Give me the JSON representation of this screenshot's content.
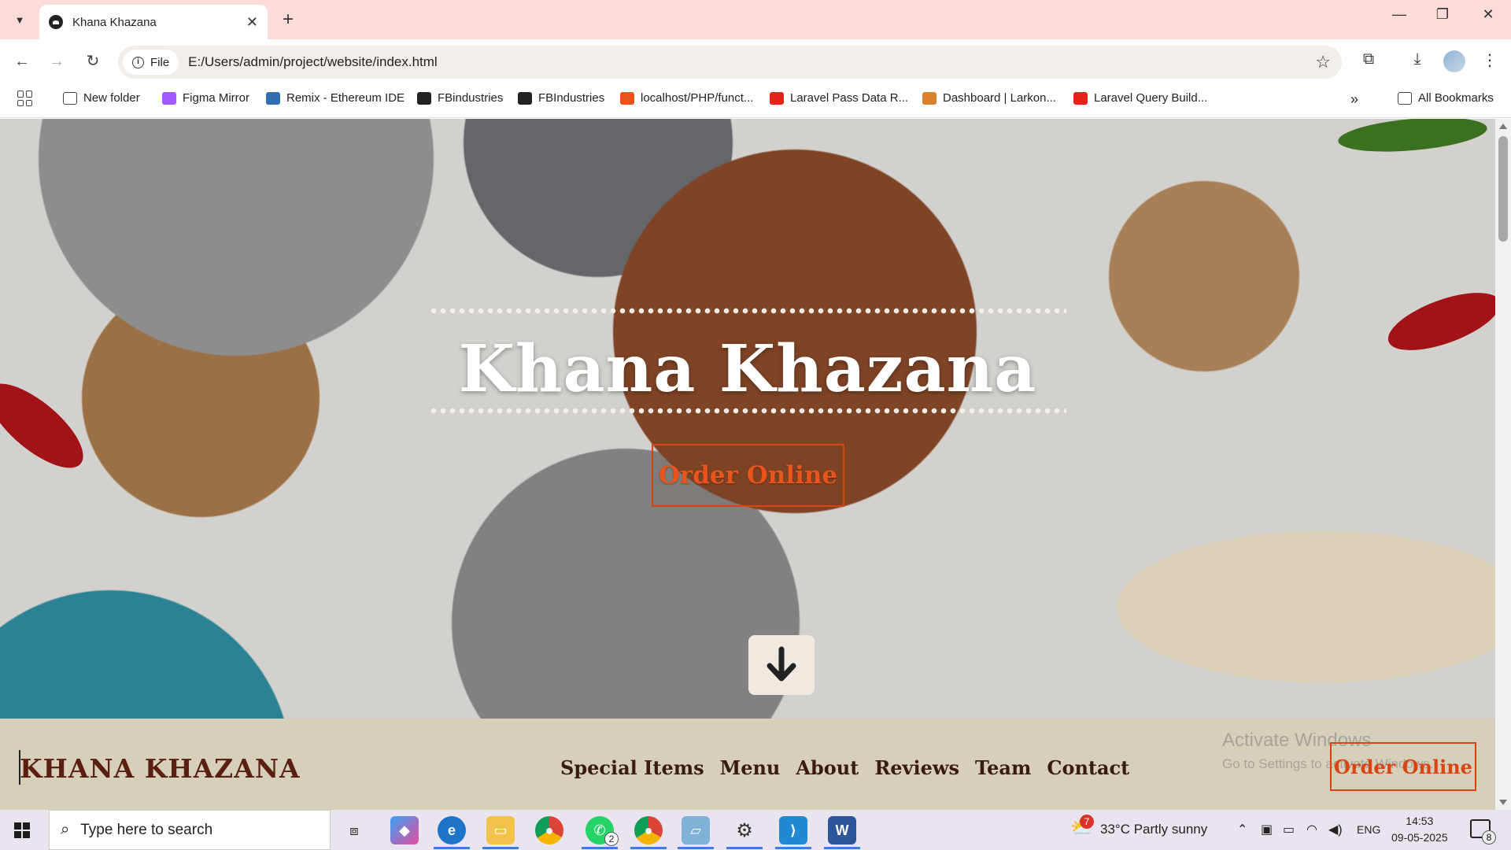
{
  "browser": {
    "tab_title": "Khana Khazana",
    "url_scheme": "File",
    "url": "E:/Users/admin/project/website/index.html",
    "bookmarks": [
      {
        "label": "New folder",
        "color": "#555555"
      },
      {
        "label": "Figma Mirror",
        "color": "#a259ff"
      },
      {
        "label": "Remix - Ethereum IDE",
        "color": "#2f6fb0"
      },
      {
        "label": "FBindustries",
        "color": "#222222"
      },
      {
        "label": "FBIndustries",
        "color": "#222222"
      },
      {
        "label": "localhost/PHP/funct...",
        "color": "#e8541c"
      },
      {
        "label": "Laravel Pass Data R...",
        "color": "#e62117"
      },
      {
        "label": "Dashboard | Larkon...",
        "color": "#d9822b"
      },
      {
        "label": "Laravel Query Build...",
        "color": "#e62117"
      }
    ],
    "all_bookmarks": "All Bookmarks",
    "overflow": "»"
  },
  "page": {
    "hero_title": "Khana Khazana",
    "hero_cta": "Order Online",
    "brand": "KHANA KHAZANA",
    "nav": [
      "Special Items",
      "Menu",
      "About",
      "Reviews",
      "Team",
      "Contact"
    ],
    "nav_cta": "Order Online",
    "accent": "#d94412",
    "brand_color": "#5a1f10",
    "navbar_bg": "#d6d0bb"
  },
  "watermark": {
    "line1": "Activate Windows",
    "line2": "Go to Settings to activate Windows."
  },
  "taskbar": {
    "search_placeholder": "Type here to search",
    "whatsapp_badge": "2",
    "weather_badge": "7",
    "weather": "33°C  Partly sunny",
    "language": "ENG",
    "time": "14:53",
    "date": "09-05-2025",
    "notifications": "8"
  }
}
